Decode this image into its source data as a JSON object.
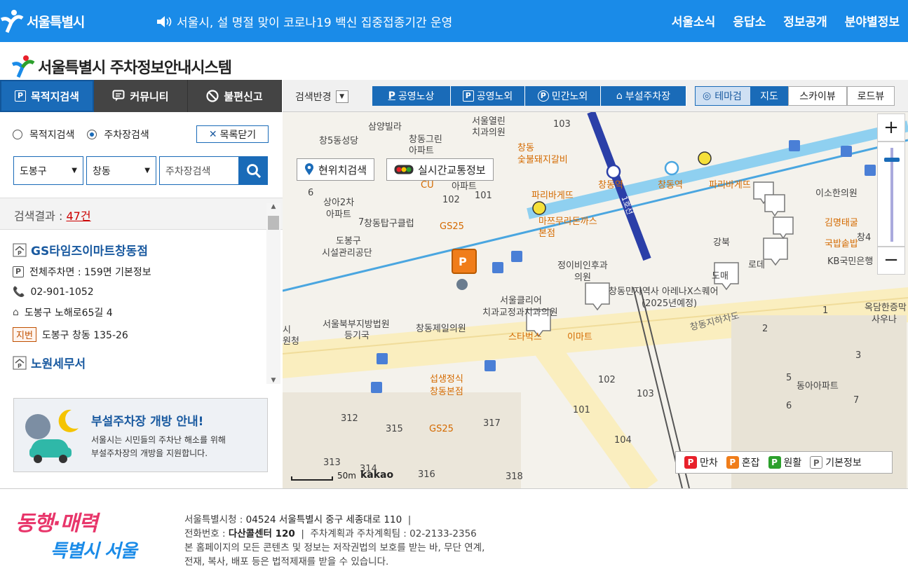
{
  "top": {
    "logo": "서울특별시",
    "notice": "서울시, 설 명절 맞이 코로나19 백신 집중접종기간 운영",
    "gnb": [
      "서울소식",
      "응답소",
      "정보공개",
      "분야별정보"
    ]
  },
  "brand": {
    "title": "서울특별시 주차정보안내시스템"
  },
  "left": {
    "tabs": [
      "목적지검색",
      "커뮤니티",
      "불편신고"
    ],
    "radio1": "목적지검색",
    "radio2": "주차장검색",
    "close": "목록닫기",
    "district": "도봉구",
    "dong": "창동",
    "search_placeholder": "주차장검색",
    "result_label": "검색결과 :",
    "result_count": "47건",
    "items": [
      {
        "name": "GS타임즈이마트창동점",
        "info": "전체주차면 : 159면 기본정보",
        "phone": "02-901-1052",
        "address": "도봉구 노해로65길 4",
        "jibun_label": "지번",
        "jibun": "도봉구 창동 135-26"
      },
      {
        "name": "노원세무서"
      }
    ],
    "banner": {
      "title": "부설주차장 개방 안내!",
      "line1": "서울시는 시민들의 주차난 해소를 위해",
      "line2": "부설주차장의 개방을 지원합니다."
    }
  },
  "mapbar": {
    "label": "검색반경",
    "layers": [
      "공영노상",
      "공영노외",
      "민간노외",
      "부설주차장"
    ],
    "theme": "테마검",
    "views": [
      "지도",
      "스카이뷰",
      "로드뷰"
    ]
  },
  "map": {
    "locate": "현위치검색",
    "traffic": "실시간교통정보",
    "scale": "50m",
    "provider": "kakao",
    "legend": [
      {
        "label": "만차",
        "color": "#e8202a"
      },
      {
        "label": "혼잡",
        "color": "#f07d1a"
      },
      {
        "label": "원활",
        "color": "#2ca02c"
      },
      {
        "label": "기본정보",
        "color": "#888888"
      }
    ],
    "labels": [
      "삼양빌라",
      "서울열린",
      "치과의원",
      "창5동성당",
      "창동그린",
      "아파트",
      "창동",
      "숯불돼지갈비",
      "103",
      "파리바게뜨",
      "창동역",
      "창동역",
      "1호선",
      "파리바게뜨",
      "이소한의원",
      "CU",
      "아파트",
      "102",
      "101",
      "마쯔무라돈까스",
      "본점",
      "상아2차",
      "아파트",
      "6",
      "7",
      "창동탑구클럽",
      "GS25",
      "도봉구",
      "시설관리공단",
      "정이비인후과",
      "의원",
      "김명태굴",
      "국밥솥밥",
      "KB국민은행",
      "창동민자역사 아레나X스퀘어",
      "(2025년예정)",
      "서울클리어",
      "치과교정과치과의원",
      "서울북부지방법원",
      "등기국",
      "창동제일의원",
      "옥담한증막",
      "사우나",
      "창동지하차도",
      "스타벅스",
      "이마트",
      "시",
      "원청",
      "섭생정식",
      "창동본점",
      "102",
      "103",
      "2",
      "1",
      "3",
      "5",
      "동아아파트",
      "6",
      "7",
      "312",
      "315",
      "317",
      "101",
      "104",
      "GS25",
      "313",
      "314",
      "316",
      "318",
      "창4",
      "로데",
      "강북",
      "도매"
    ]
  },
  "footer": {
    "line1a": "서울특별시청 : ",
    "line1b": "04524 서울특별시 중구 세종대로 110",
    "line2a": "전화번호 : ",
    "line2b": "다산콜센터 120",
    "line2c": "주차계획과 주차계획팀 : 02-2133-2356",
    "line3": "본 홈페이지의 모든 콘텐츠 및 정보는 저작권법의 보호를 받는 바, 무단 연계,",
    "line4": "전재, 복사, 배포 등은 법적제재를 받을 수 있습니다.",
    "slogan1": "동행·매력",
    "slogan2": "특별시 서울"
  }
}
